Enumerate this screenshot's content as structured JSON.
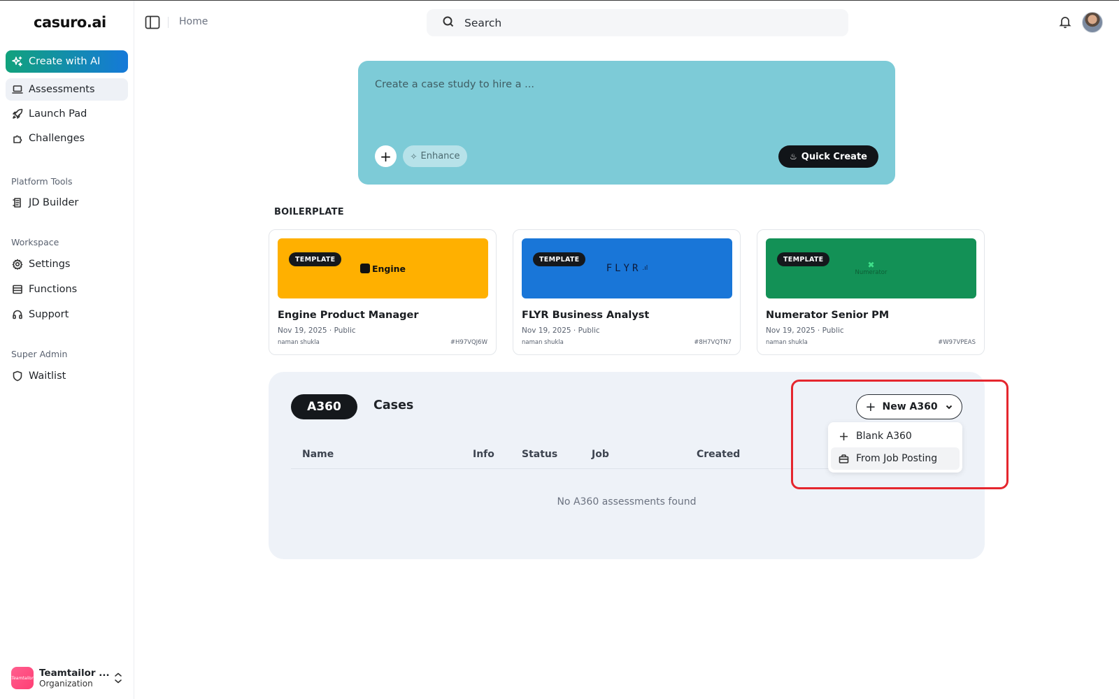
{
  "app": {
    "logo": "casuro.ai",
    "breadcrumb": "Home"
  },
  "search": {
    "placeholder": "Search"
  },
  "sidebar": {
    "create_label": "Create with AI",
    "items": [
      {
        "label": "Assessments",
        "icon": "laptop-icon",
        "active": true
      },
      {
        "label": "Launch Pad",
        "icon": "rocket-icon"
      },
      {
        "label": "Challenges",
        "icon": "puzzle-icon"
      }
    ],
    "platform_tools_label": "Platform Tools",
    "platform_tools": [
      {
        "label": "JD Builder",
        "icon": "document-icon"
      }
    ],
    "workspace_label": "Workspace",
    "workspace": [
      {
        "label": "Settings",
        "icon": "gear-icon"
      },
      {
        "label": "Functions",
        "icon": "table-icon"
      },
      {
        "label": "Support",
        "icon": "headphones-icon"
      }
    ],
    "super_admin_label": "Super Admin",
    "super_admin": [
      {
        "label": "Waitlist",
        "icon": "shield-icon"
      }
    ],
    "org": {
      "name": "Teamtailor ...",
      "role": "Organization",
      "avatar_text": "Teamtailor"
    }
  },
  "prompt": {
    "placeholder": "Create a case study to hire a ...",
    "enhance_label": "Enhance",
    "quick_create_label": "Quick Create",
    "bg_color": "#7dcbd7"
  },
  "boilerplate": {
    "heading": "BOILERPLATE",
    "cards": [
      {
        "tag": "TEMPLATE",
        "brand": "Engine",
        "title": "Engine Product Manager",
        "meta": "Nov 19, 2025 · Public",
        "author": "naman shukla",
        "id": "#H97VQJ6W",
        "color": "#ffb000"
      },
      {
        "tag": "TEMPLATE",
        "brand": "FLYR",
        "title": "FLYR Business Analyst",
        "meta": "Nov 19, 2025 · Public",
        "author": "naman shukla",
        "id": "#8H7VQTN7",
        "color": "#1976d8"
      },
      {
        "tag": "TEMPLATE",
        "brand": "Numerator",
        "title": "Numerator Senior PM",
        "meta": "Nov 19, 2025 · Public",
        "author": "naman shukla",
        "id": "#W97VPEAS",
        "color": "#139156"
      }
    ]
  },
  "assessments": {
    "tabs": [
      "A360",
      "Cases"
    ],
    "new_button_label": "New A360",
    "menu": [
      {
        "label": "Blank A360",
        "icon": "plus-icon"
      },
      {
        "label": "From Job Posting",
        "icon": "briefcase-icon"
      }
    ],
    "columns": [
      "Name",
      "Info",
      "Status",
      "Job",
      "Created"
    ],
    "empty_text": "No A360 assessments found"
  },
  "colors": {
    "accent_gradient_start": "#11a27c",
    "accent_gradient_end": "#1579d9",
    "highlight": "#e5262e"
  }
}
